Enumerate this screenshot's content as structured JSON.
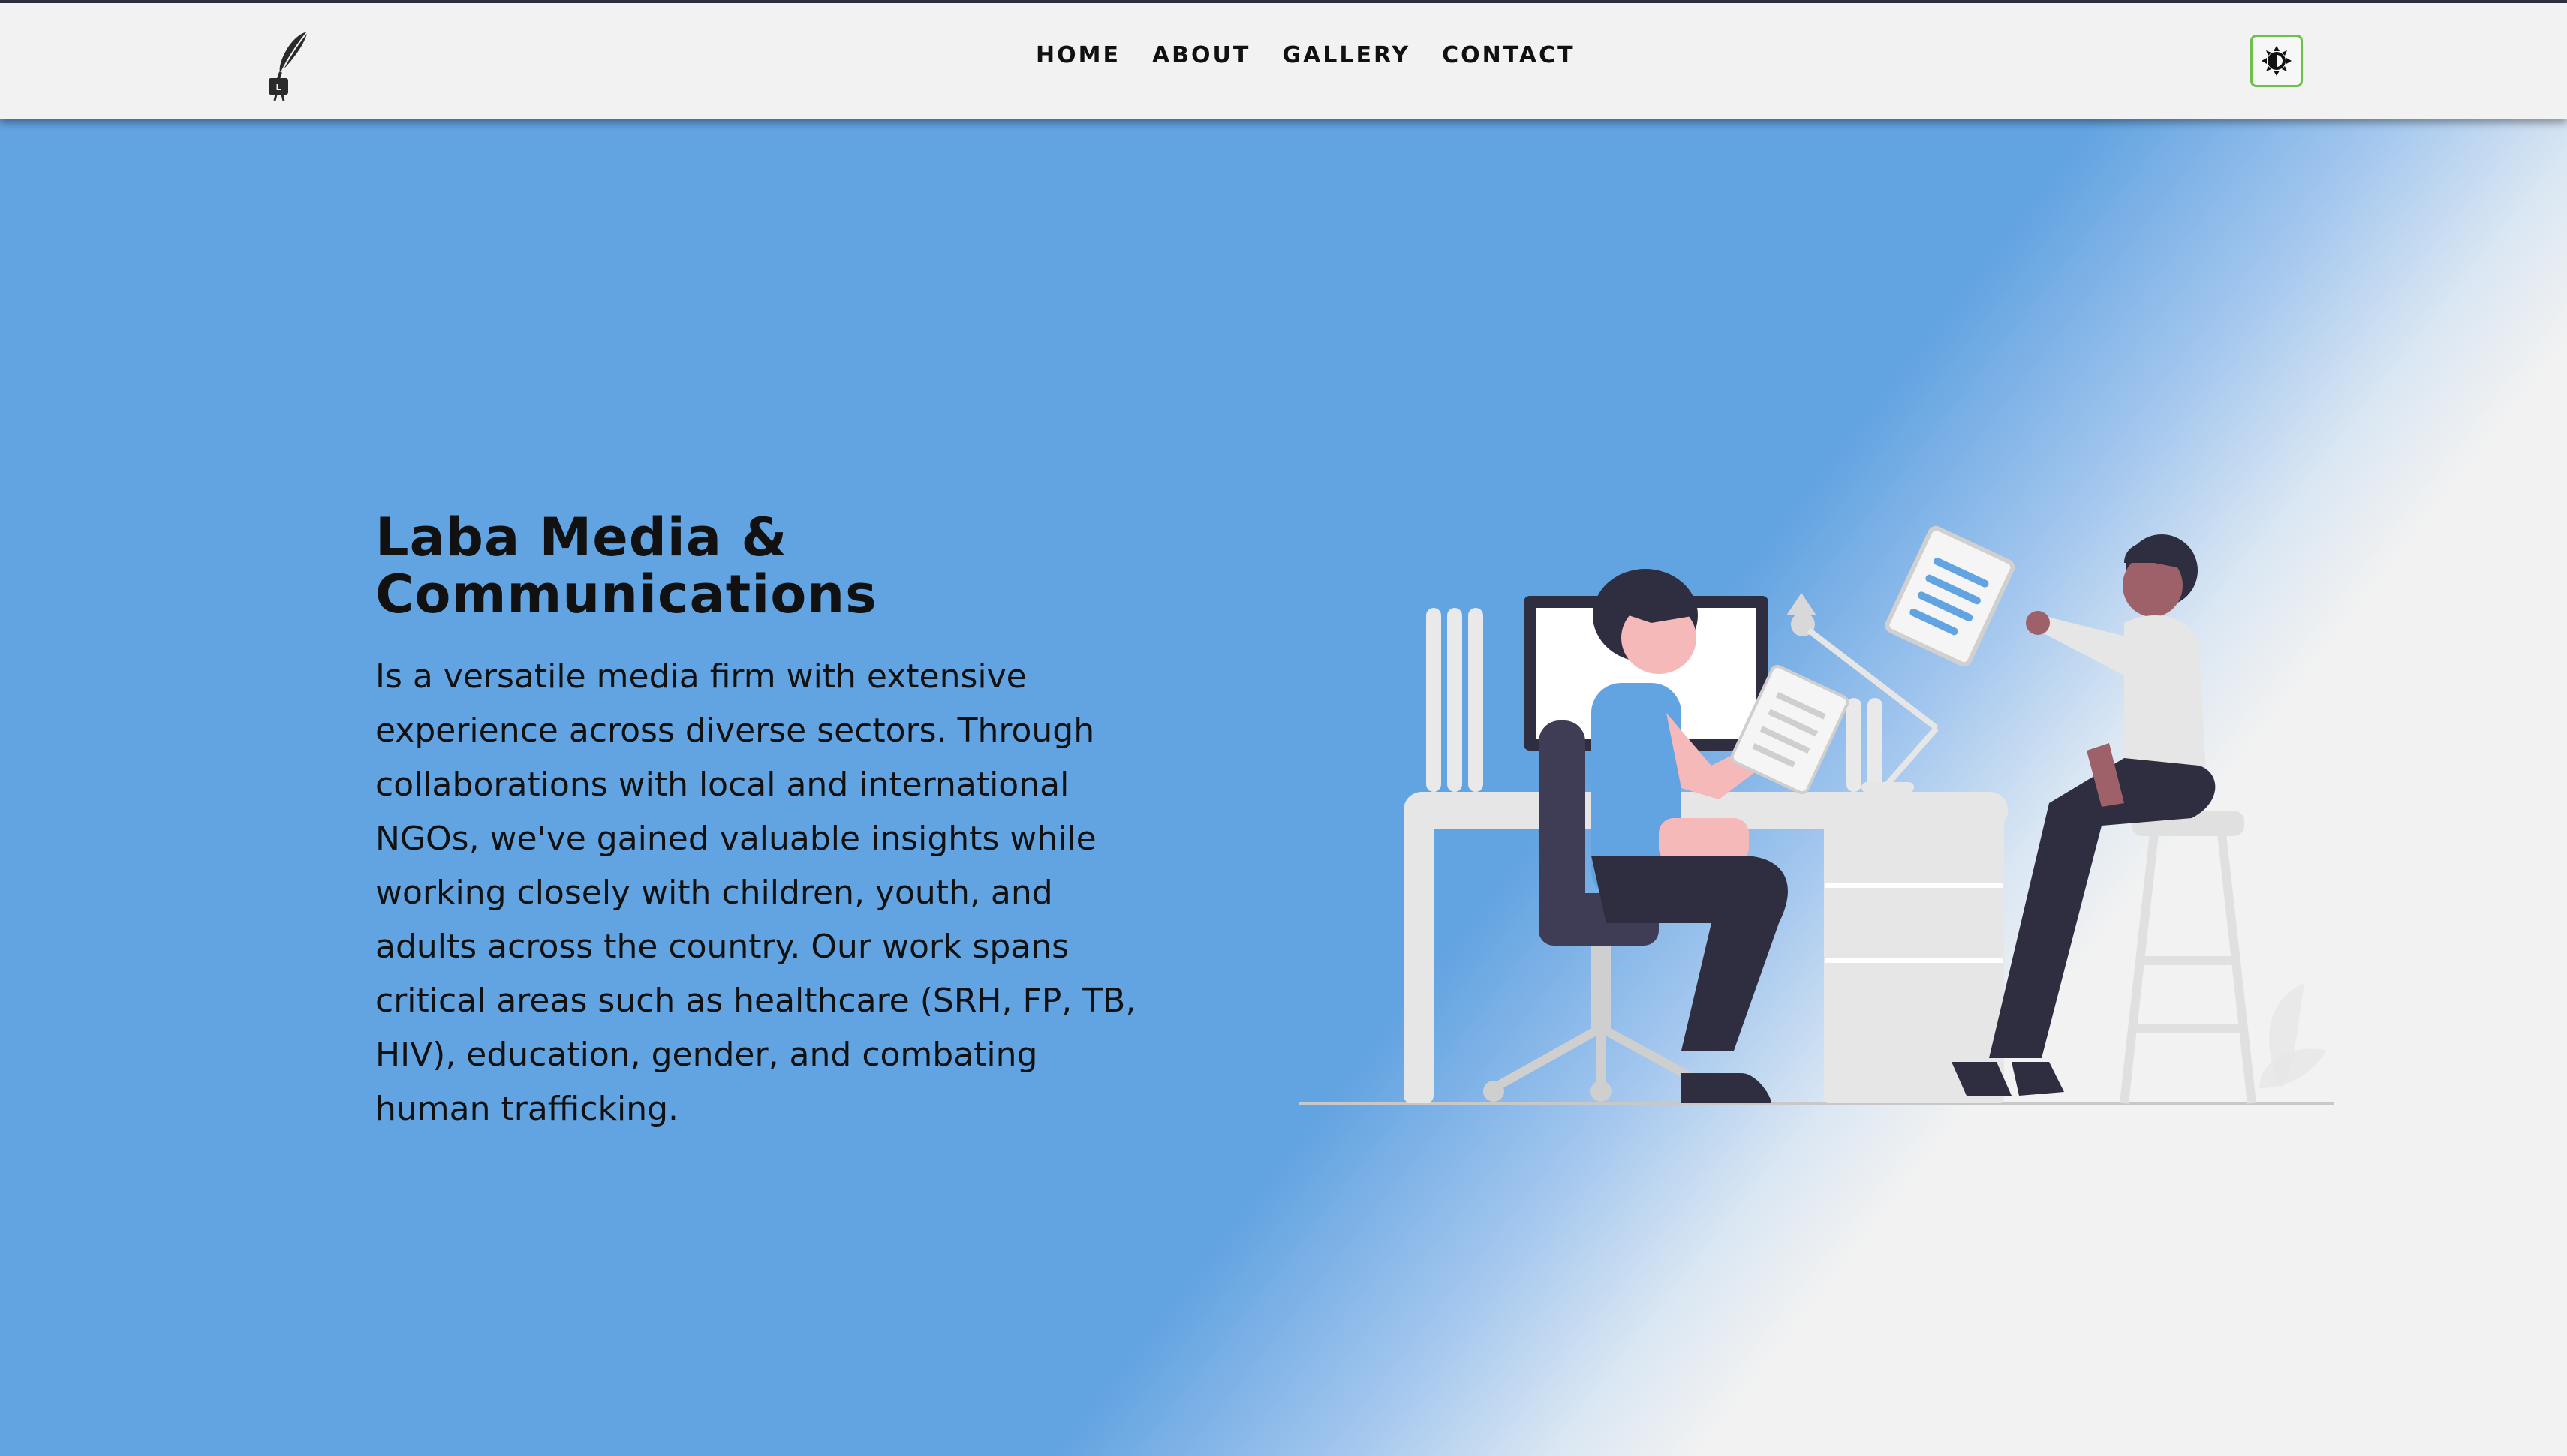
{
  "nav": {
    "logo_icon": "quill-pen-logo-icon",
    "links": [
      {
        "label": "HOME"
      },
      {
        "label": "ABOUT"
      },
      {
        "label": "GALLERY"
      },
      {
        "label": "CONTACT"
      }
    ],
    "theme_toggle_icon": "contrast-sun-icon"
  },
  "hero": {
    "title_line1": "Laba Media &",
    "title_line2": "Communications",
    "description": "Is a versatile media firm with extensive experience across diverse sectors. Through collaborations with local and international NGOs, we've gained valuable insights while working closely with children, youth, and adults across the country. Our work spans critical areas such as healthcare (SRH, FP, TB, HIV), education, gender, and combating human trafficking.",
    "illustration": "office-collaboration-illustration"
  },
  "colors": {
    "hero_blue": "#62a3e1",
    "background": "#f2f2f2",
    "toggle_border": "#6cc04a",
    "text": "#111111"
  }
}
